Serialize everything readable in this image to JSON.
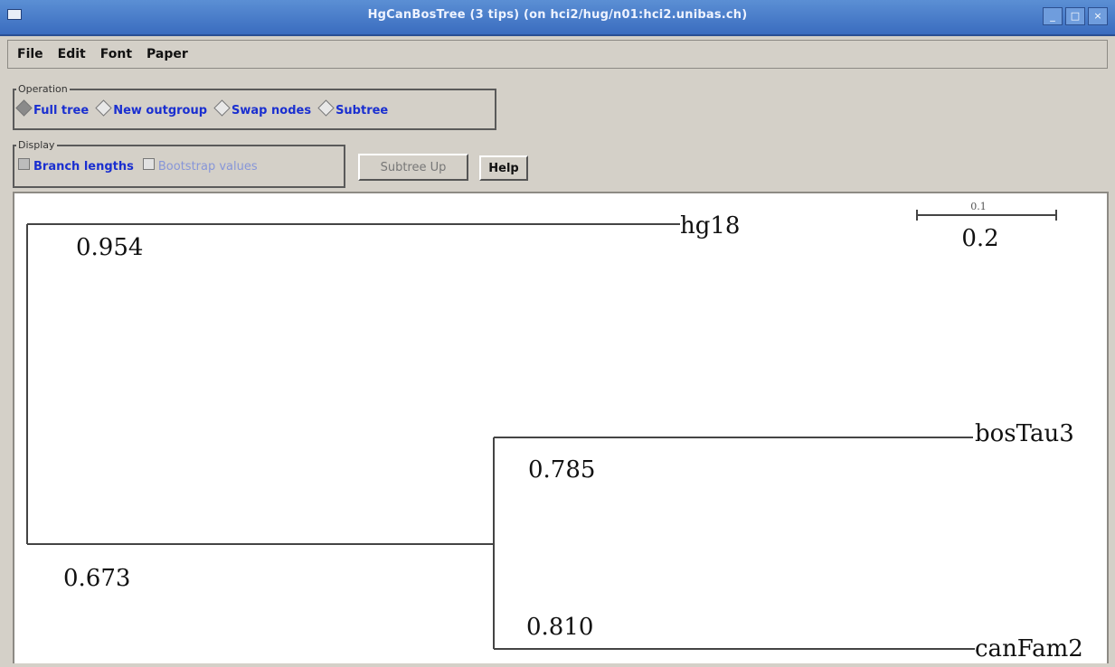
{
  "window": {
    "title": "HgCanBosTree (3 tips) (on hci2/hug/n01:hci2.unibas.ch)",
    "buttons": [
      "_",
      "□",
      "×"
    ]
  },
  "menu": [
    "File",
    "Edit",
    "Font",
    "Paper"
  ],
  "operation": {
    "legend": "Operation",
    "options": [
      {
        "label": "Full tree",
        "selected": true
      },
      {
        "label": "New outgroup",
        "selected": false
      },
      {
        "label": "Swap nodes",
        "selected": false
      },
      {
        "label": "Subtree",
        "selected": false
      }
    ]
  },
  "display": {
    "legend": "Display",
    "branch_lengths": {
      "label": "Branch lengths",
      "checked": true
    },
    "bootstrap": {
      "label": "Bootstrap values",
      "checked": false,
      "enabled": false
    }
  },
  "buttons": {
    "subtree_up": "Subtree Up",
    "help": "Help"
  },
  "tree": {
    "scale_bar_top": "0.1",
    "scale_bar_value": "0.2",
    "leaves": [
      "hg18",
      "bosTau3",
      "canFam2"
    ],
    "branch_values": [
      "0.954",
      "0.785",
      "0.673",
      "0.810"
    ]
  }
}
